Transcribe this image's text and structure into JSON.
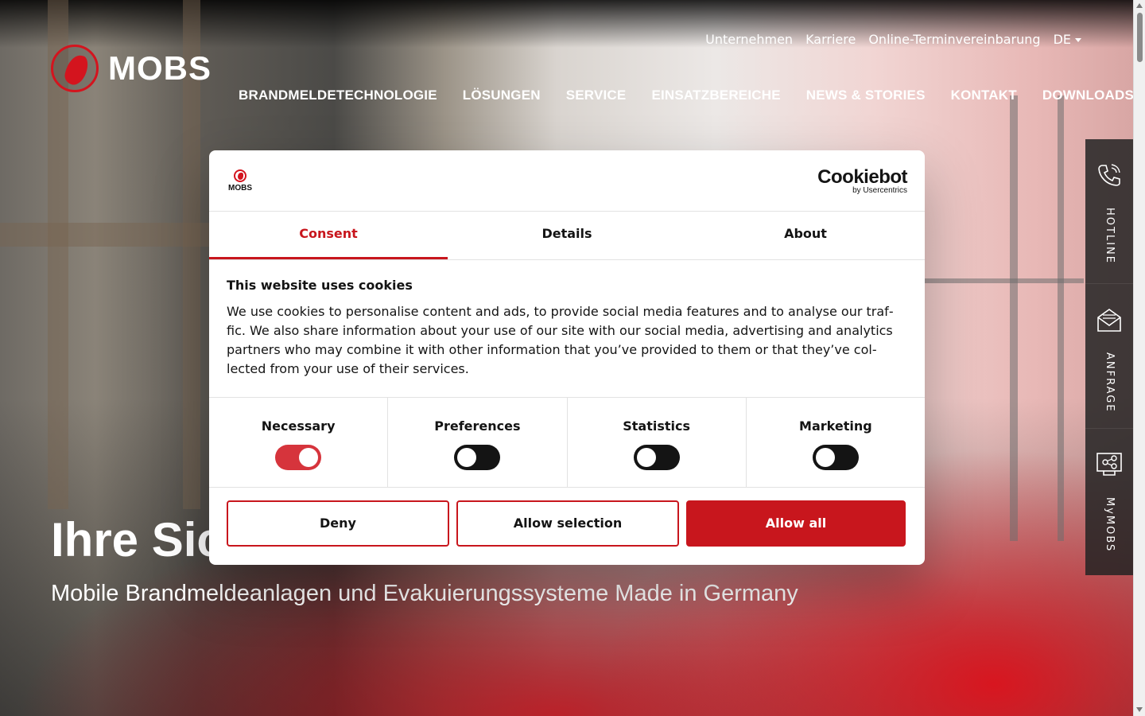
{
  "brand": {
    "name": "MOBS",
    "accent": "#c8161d"
  },
  "top_links": [
    "Unternehmen",
    "Karriere",
    "Online-Terminvereinbarung"
  ],
  "language": "DE",
  "main_nav": [
    "BRANDMELDETECHNOLOGIE",
    "LÖSUNGEN",
    "SERVICE",
    "EINSATZBEREICHE",
    "NEWS & STORIES",
    "KONTAKT",
    "DOWNLOADS"
  ],
  "hero": {
    "title": "Ihre Sic",
    "subtitle": "Mobile Brandmeldeanlagen und Evakuierungssysteme Made in Germany"
  },
  "side_tabs": [
    {
      "label": "HOTLINE",
      "icon": "phone-icon"
    },
    {
      "label": "ANFRAGE",
      "icon": "envelope-icon"
    },
    {
      "label": "MyMOBS",
      "icon": "network-icon"
    }
  ],
  "cookie_dialog": {
    "logo_text": "MOBS",
    "provider": "Cookiebot",
    "provider_by": "by Usercentrics",
    "tabs": [
      "Consent",
      "Details",
      "About"
    ],
    "active_tab": "Consent",
    "heading": "This website uses cookies",
    "body": "We use cookies to personalise content and ads, to provide social media features and to analyse our traf­fic. We also share information about your use of our site with our social media, advertising and analytics partners who may combine it with other information that you’ve provided to them or that they’ve col­lected from your use of their services.",
    "categories": [
      {
        "label": "Necessary",
        "enabled": true
      },
      {
        "label": "Preferences",
        "enabled": false
      },
      {
        "label": "Statistics",
        "enabled": false
      },
      {
        "label": "Marketing",
        "enabled": false
      }
    ],
    "buttons": {
      "deny": "Deny",
      "allow_selection": "Allow selection",
      "allow_all": "Allow all"
    }
  }
}
